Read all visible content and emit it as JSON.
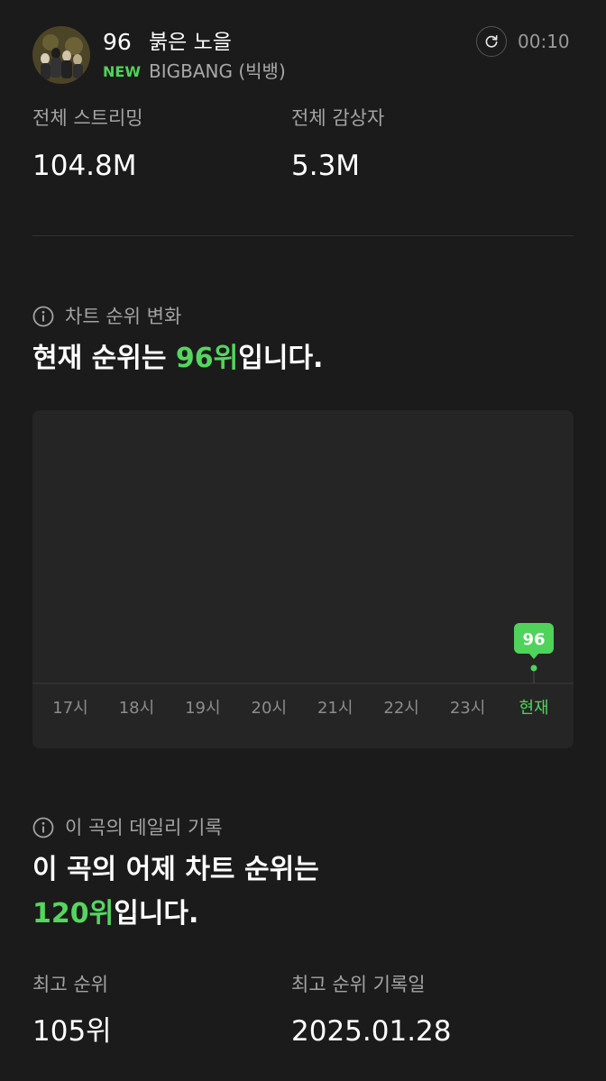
{
  "header": {
    "rank": "96",
    "title": "붉은 노을",
    "badge": "NEW",
    "artist": "BIGBANG (빅뱅)",
    "refresh_icon": "refresh-icon",
    "timer": "00:10"
  },
  "stats": {
    "total_streams_label": "전체 스트리밍",
    "total_streams_value": "104.8M",
    "total_listeners_label": "전체 감상자",
    "total_listeners_value": "5.3M"
  },
  "rank_change": {
    "section_label": "차트 순위 변화",
    "headline_prefix": "현재 순위는 ",
    "headline_highlight": "96위",
    "headline_suffix": "입니다."
  },
  "chart_data": {
    "type": "line",
    "categories": [
      "17시",
      "18시",
      "19시",
      "20시",
      "21시",
      "22시",
      "23시",
      "현재"
    ],
    "series": [
      {
        "values": [
          null,
          null,
          null,
          null,
          null,
          null,
          null,
          96
        ]
      }
    ],
    "current_label": "96",
    "accent_color": "#4fd35a",
    "grid": false
  },
  "daily_record": {
    "section_label": "이 곡의 데일리 기록",
    "headline_line1": "이 곡의 어제 차트 순위는",
    "headline_highlight": "120위",
    "headline_suffix": "입니다.",
    "best_rank_label": "최고 순위",
    "best_rank_value": "105위",
    "best_rank_date_label": "최고 순위 기록일",
    "best_rank_date_value": "2025.01.28"
  },
  "colors": {
    "background": "#1b1b1b",
    "card": "#252525",
    "accent": "#4fd35a",
    "muted_text": "#a3a3a3"
  }
}
